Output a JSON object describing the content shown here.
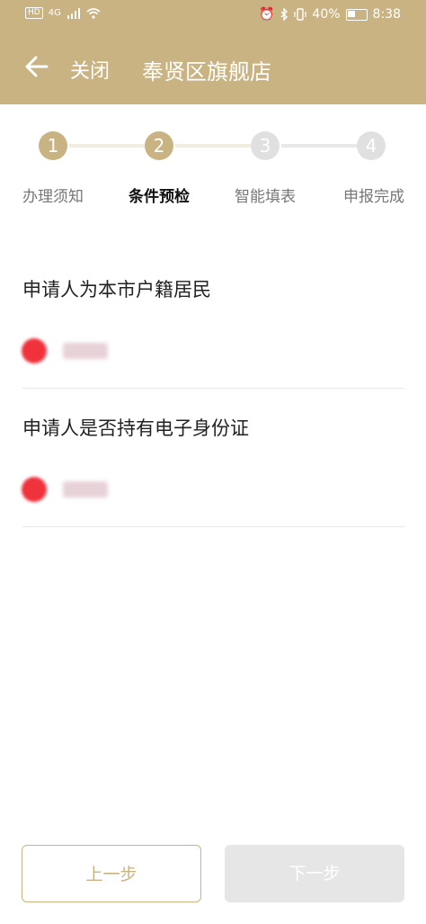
{
  "status_bar": {
    "hd": "HD",
    "network": "4G",
    "battery": "40%",
    "time": "8:38"
  },
  "header": {
    "close_label": "关闭",
    "title": "奉贤区旗舰店"
  },
  "steps": [
    {
      "number": "1",
      "label": "办理须知",
      "state": "done"
    },
    {
      "number": "2",
      "label": "条件预检",
      "state": "active"
    },
    {
      "number": "3",
      "label": "智能填表",
      "state": "pending"
    },
    {
      "number": "4",
      "label": "申报完成",
      "state": "pending"
    }
  ],
  "questions": [
    {
      "text": "申请人为本市户籍居民"
    },
    {
      "text": "申请人是否持有电子身份证"
    }
  ],
  "buttons": {
    "prev": "上一步",
    "next": "下一步"
  },
  "colors": {
    "accent": "#c9b383",
    "disabled": "#e6e6e6",
    "pending_step": "#e0e0e0"
  }
}
